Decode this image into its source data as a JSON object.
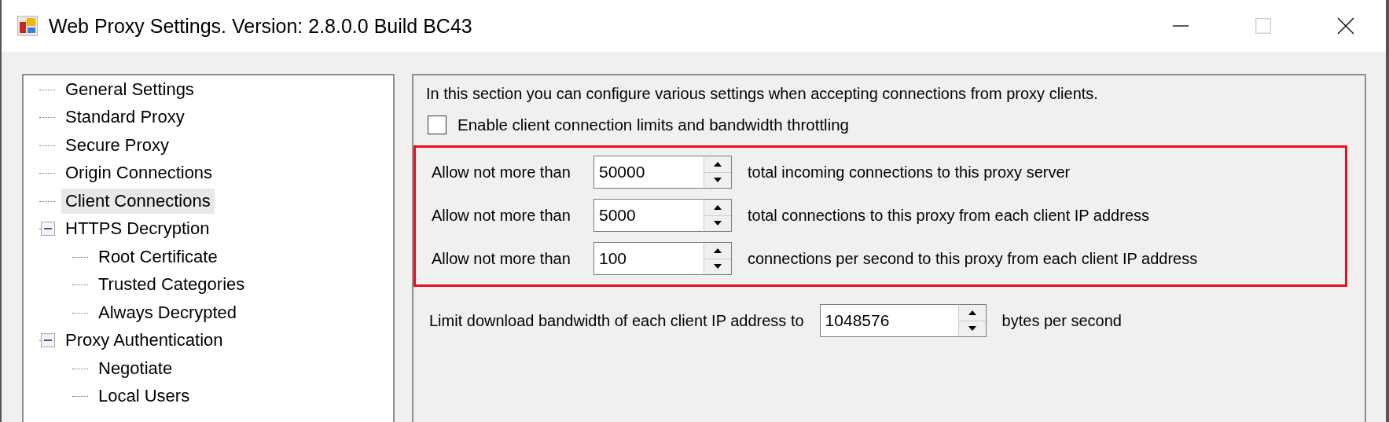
{
  "window": {
    "title": "Web Proxy Settings. Version: 2.8.0.0 Build BC43"
  },
  "tree": [
    {
      "label": "General Settings",
      "selected": false
    },
    {
      "label": "Standard Proxy",
      "selected": false
    },
    {
      "label": "Secure Proxy",
      "selected": false
    },
    {
      "label": "Origin Connections",
      "selected": false
    },
    {
      "label": "Client Connections",
      "selected": true
    },
    {
      "label": "HTTPS Decryption",
      "selected": false,
      "expanded": true,
      "children": [
        {
          "label": "Root Certificate",
          "selected": false
        },
        {
          "label": "Trusted Categories",
          "selected": false
        },
        {
          "label": "Always Decrypted",
          "selected": false
        }
      ]
    },
    {
      "label": "Proxy Authentication",
      "selected": false,
      "expanded": true,
      "children": [
        {
          "label": "Negotiate",
          "selected": false
        },
        {
          "label": "Local Users",
          "selected": false
        }
      ]
    }
  ],
  "panel": {
    "description": "In this section you can configure various settings when accepting connections from proxy clients.",
    "enable_checkbox": {
      "label": "Enable client connection limits and bandwidth throttling",
      "checked": false
    },
    "limits": [
      {
        "label": "Allow not more than",
        "value": "50000",
        "suffix": "total incoming connections to this proxy server"
      },
      {
        "label": "Allow not more than",
        "value": "5000",
        "suffix": "total connections to this proxy from each client IP address"
      },
      {
        "label": "Allow not more than",
        "value": "100",
        "suffix": "connections per second to this proxy from each client IP address"
      }
    ],
    "bandwidth": {
      "label": "Limit download bandwidth of each client IP address to",
      "value": "1048576",
      "suffix": "bytes per second"
    }
  }
}
